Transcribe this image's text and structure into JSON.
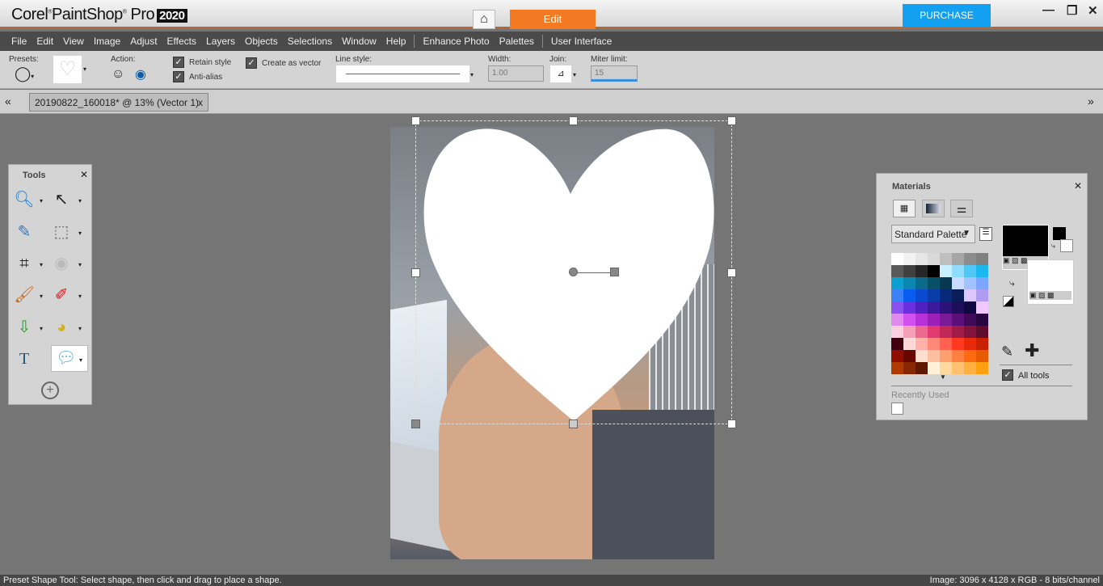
{
  "app": {
    "brand": "Corel",
    "product": "PaintShop",
    "product2": "Pro",
    "year": "2020"
  },
  "workspace_tabs": {
    "home_icon": "home-icon",
    "edit": "Edit"
  },
  "purchase_label": "PURCHASE",
  "menu": [
    "File",
    "Edit",
    "View",
    "Image",
    "Adjust",
    "Effects",
    "Layers",
    "Objects",
    "Selections",
    "Window",
    "Help",
    "Enhance Photo",
    "Palettes",
    "User Interface"
  ],
  "options": {
    "presets_label": "Presets:",
    "action_label": "Action:",
    "retain_style": "Retain style",
    "anti_alias": "Anti-alias",
    "create_as_vector": "Create as vector",
    "line_style_label": "Line style:",
    "width_label": "Width:",
    "width_value": "1.00",
    "join_label": "Join:",
    "miter_label": "Miter limit:",
    "miter_value": "15"
  },
  "document_tab": {
    "title": "20190822_160018* @  13% (Vector 1)",
    "close": "x"
  },
  "tools_panel": {
    "title": "Tools",
    "close": "✕"
  },
  "materials": {
    "title": "Materials",
    "close": "✕",
    "palette_select": "Standard Palette",
    "all_tools": "All tools",
    "recently_used": "Recently Used",
    "foreground": "#000000",
    "background": "#ffffff",
    "swatches": [
      "#ffffff",
      "#f2f2f2",
      "#e6e6e6",
      "#d9d9d9",
      "#bfbfbf",
      "#a6a6a6",
      "#8c8c8c",
      "#808080",
      "#595959",
      "#404040",
      "#262626",
      "#000000",
      "#c6efff",
      "#8fdcff",
      "#4fc8f5",
      "#1ab8ef",
      "#0aa0d0",
      "#0a86b0",
      "#0a6a8a",
      "#085068",
      "#063850",
      "#c9dcff",
      "#a3c3ff",
      "#7aa6ff",
      "#3b82f6",
      "#0a5cf0",
      "#0a4ad0",
      "#0a3ca8",
      "#08287a",
      "#0a1e5a",
      "#dcc8ff",
      "#b09cf0",
      "#8a50f0",
      "#6a30e0",
      "#5020c0",
      "#3a1a9a",
      "#2a1278",
      "#1e0e5a",
      "#100840",
      "#f0c8ff",
      "#e08af0",
      "#d050f0",
      "#b830d8",
      "#9a20b8",
      "#7a1a98",
      "#5a1078",
      "#400a58",
      "#2a0640",
      "#f8d0e0",
      "#f4a0b8",
      "#ec6a90",
      "#e03a70",
      "#c02858",
      "#a01c48",
      "#80143a",
      "#600c2c",
      "#400010",
      "#ffd8d8",
      "#ffb0a8",
      "#ff8878",
      "#ff6050",
      "#ff3a20",
      "#e82a0a",
      "#c82000",
      "#900e00",
      "#680600",
      "#ffe0d0",
      "#ffc0a0",
      "#ffa070",
      "#ff8040",
      "#ff6a10",
      "#e85a00",
      "#b03a00",
      "#882800",
      "#601800",
      "#fff0d8",
      "#ffd8a0",
      "#ffc070",
      "#ffb040",
      "#ffa010"
    ]
  },
  "status": {
    "hint": "Preset Shape Tool: Select shape, then click and drag to place a shape.",
    "image_info": "Image:  3096 x 4128 x RGB - 8 bits/channel"
  },
  "colors": {
    "accent": "#f37a22",
    "purchase": "#13a0f0",
    "menubar": "#4a4a4a"
  }
}
